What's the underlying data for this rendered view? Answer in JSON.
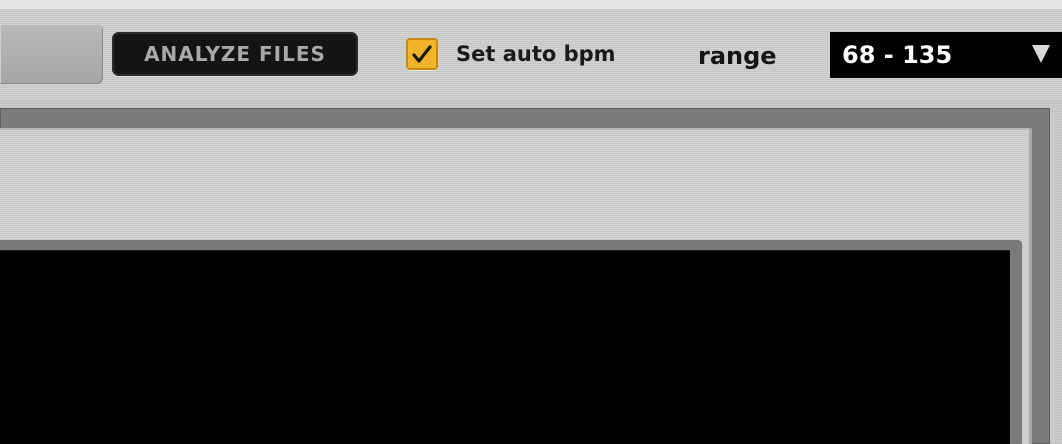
{
  "toolbar": {
    "analyze_label": "ANALYZE FILES",
    "auto_bpm": {
      "label": "Set auto bpm",
      "checked": true
    },
    "range": {
      "label": "range",
      "value": "68 - 135"
    }
  },
  "colors": {
    "checkbox": "#f0b329",
    "display": "#000000",
    "analyze_button": "#141414"
  },
  "icons": {
    "checkmark": "check-icon",
    "dropdown": "triangle-down-icon"
  }
}
